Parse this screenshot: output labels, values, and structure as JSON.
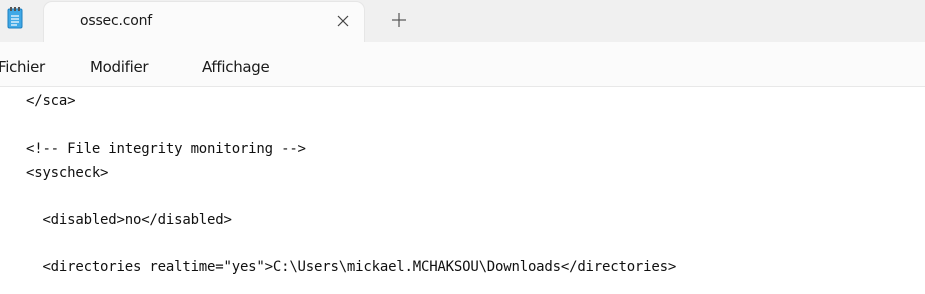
{
  "window": {
    "tab_title": "ossec.conf",
    "tab_close_icon": "close-icon",
    "new_tab_icon": "plus-icon",
    "app_icon": "notepad-icon"
  },
  "menu": {
    "items": [
      "Fichier",
      "Modifier",
      "Affichage"
    ]
  },
  "editor": {
    "lines": [
      "</sca>",
      "",
      "<!-- File integrity monitoring -->",
      "<syscheck>",
      "",
      "  <disabled>no</disabled>",
      "",
      "  <directories realtime=\"yes\">C:\\Users\\mickael.MCHAKSOU\\Downloads</directories>"
    ]
  },
  "colors": {
    "tabbar_bg": "#f0f0f0",
    "tab_bg": "#fbfbfb",
    "editor_bg": "#ffffff",
    "notepad_icon": "#2d9bd8"
  }
}
